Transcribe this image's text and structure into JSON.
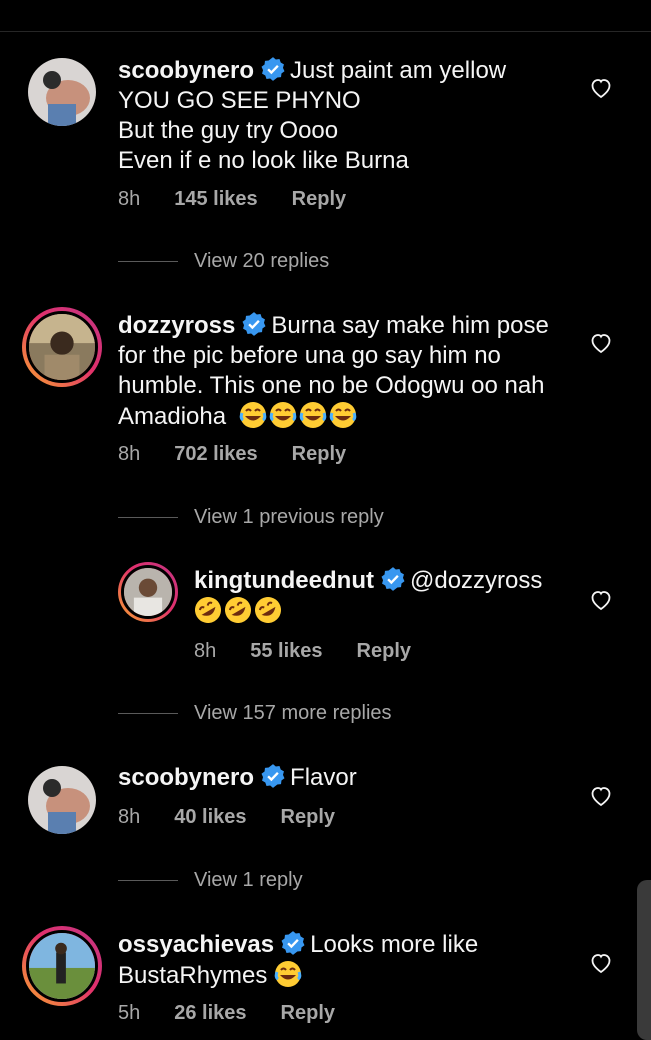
{
  "comments": [
    {
      "username": "scoobynero",
      "text_lines": [
        "Just paint am yellow",
        "YOU GO SEE PHYNO",
        "But the guy try Oooo",
        "Even if e no look like Burna"
      ],
      "time": "8h",
      "likes": "145 likes",
      "reply": "Reply",
      "view_replies": "View 20 replies"
    },
    {
      "username": "dozzyross",
      "text_lines": [
        "Burna say make him pose",
        "for the pic before una go say him no",
        "humble. This one no be Odogwu oo nah",
        "Amadioha"
      ],
      "emoji": "laughing-tears",
      "time": "8h",
      "likes": "702 likes",
      "reply": "Reply",
      "view_replies": "View 1 previous reply"
    },
    {
      "username": "kingtundeednut",
      "text_lines": [
        "@dozzyross"
      ],
      "emoji": "rofl",
      "time": "8h",
      "likes": "55 likes",
      "reply": "Reply",
      "view_replies": "View 157 more replies"
    },
    {
      "username": "scoobynero",
      "text_lines": [
        "Flavor"
      ],
      "time": "8h",
      "likes": "40 likes",
      "reply": "Reply",
      "view_replies": "View 1 reply"
    },
    {
      "username": "ossyachievas",
      "text_lines": [
        "Looks more like",
        "BustaRhymes"
      ],
      "emoji": "laughing-tears",
      "time": "5h",
      "likes": "26 likes",
      "reply": "Reply"
    }
  ],
  "colors": {
    "background": "#000000",
    "verified": "#3897f0",
    "secondary_text": "#a8a8a8"
  }
}
